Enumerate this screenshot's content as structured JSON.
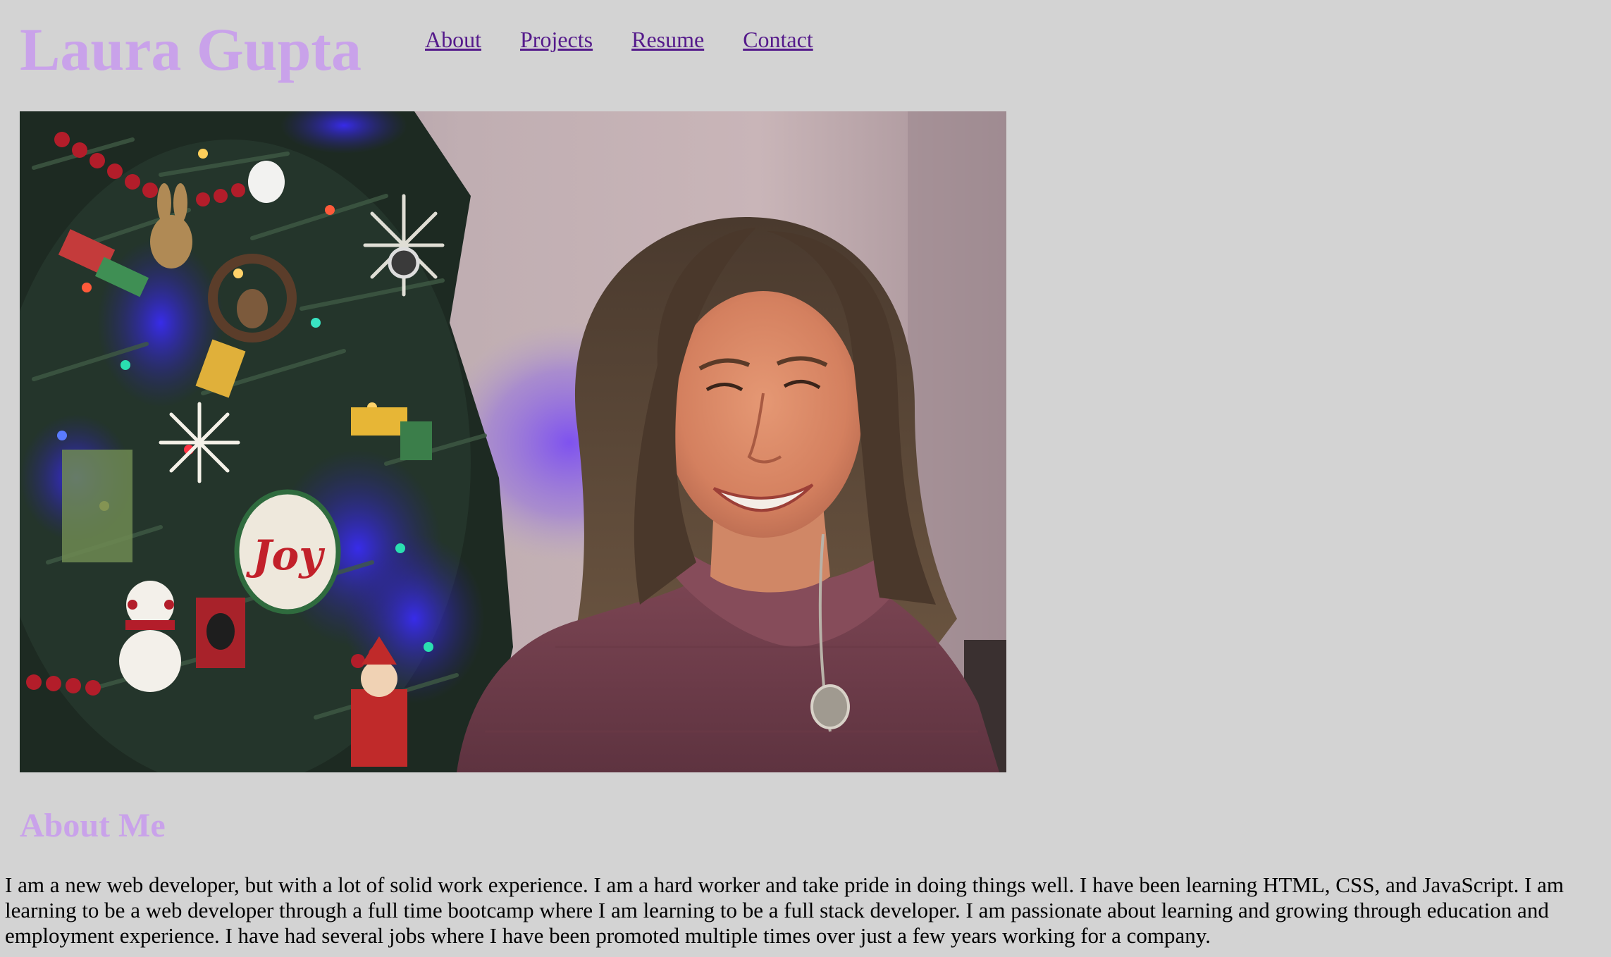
{
  "header": {
    "title": "Laura Gupta",
    "nav": [
      {
        "label": "About"
      },
      {
        "label": "Projects"
      },
      {
        "label": "Resume"
      },
      {
        "label": "Contact"
      }
    ]
  },
  "hero": {
    "description": "photo-of-laura",
    "subjects": [
      "christmas-tree",
      "ornaments",
      "smiling-woman",
      "necklace"
    ]
  },
  "about": {
    "heading": "About Me",
    "body": "I am a new web developer, but with a lot of solid work experience. I am a hard worker and take pride in doing things well. I have been learning HTML, CSS, and JavaScript. I am learning to be a web developer through a full time bootcamp where I am learning to be a full stack developer. I am passionate about learning and growing through education and employment experience. I have had several jobs where I have been promoted multiple times over just a few years working for a company."
  },
  "colors": {
    "background": "#d3d3d3",
    "accent": "#c9a2ea",
    "link": "#551a8b",
    "text": "#000000"
  }
}
